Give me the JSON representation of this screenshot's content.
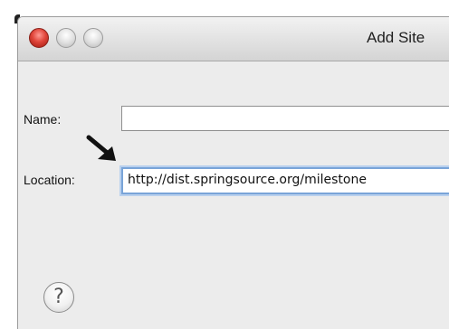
{
  "window": {
    "title": "Add Site"
  },
  "form": {
    "name_label": "Name:",
    "name_value": "",
    "location_label": "Location:",
    "location_value": "http://dist.springsource.org/milestone"
  },
  "controls": {
    "help_glyph": "?",
    "help_icon": "question-mark-icon",
    "arrow_icon": "arrow-down-right-icon"
  },
  "colors": {
    "close_button": "#e0453a",
    "focus_ring": "#79a4d8",
    "window_bg": "#ececec"
  }
}
